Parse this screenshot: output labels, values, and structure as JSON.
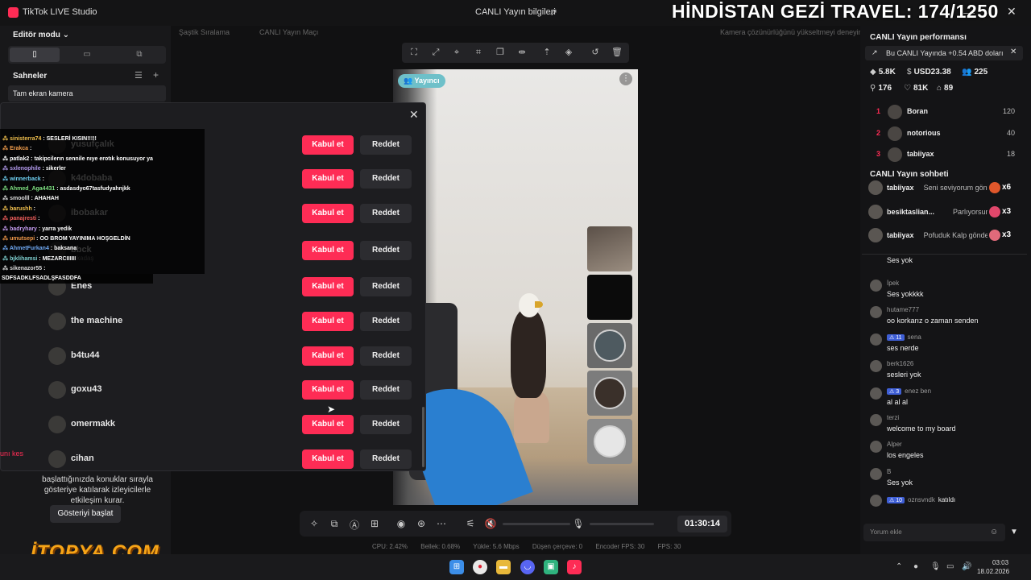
{
  "app": {
    "title": "TikTok LIVE Studio",
    "center_title": "CANLI Yayın bilgileri",
    "overlay_title": "HİNDİSTAN GEZİ TRAVEL: 174/1250"
  },
  "left": {
    "editor_mode": "Editör modu ⌄",
    "scenes_label": "Sahneler",
    "scene_item": "Tam ekran kamera",
    "show_description": "başlattığınızda konuklar sırayla gösteriye katılarak izleyicilerle etkileşim kurar.",
    "start_show": "Gösteriyi başlat",
    "cut_text": "unı kes"
  },
  "hints": {
    "h1": "Şaştik Sıralama",
    "h2": "CANLI Yayın Maçı",
    "h3": "Kamera çözünürlüğünü yükseltmeyi deneyin"
  },
  "video": {
    "badge": "👥 Yayıncı"
  },
  "modal": {
    "requests": [
      {
        "name": "yusufçalık",
        "accept": "Kabul et",
        "reject": "Reddet"
      },
      {
        "name": "k4dobaba",
        "accept": "Kabul et",
        "reject": "Reddet"
      },
      {
        "name": "ibobakar",
        "accept": "Kabul et",
        "reject": "Reddet"
      },
      {
        "name": "bbck",
        "sub": "arkadaş",
        "accept": "Kabul et",
        "reject": "Reddet"
      },
      {
        "name": "Enes",
        "accept": "Kabul et",
        "reject": "Reddet"
      },
      {
        "name": "the machine",
        "accept": "Kabul et",
        "reject": "Reddet"
      },
      {
        "name": "b4tu44",
        "accept": "Kabul et",
        "reject": "Reddet"
      },
      {
        "name": "goxu43",
        "accept": "Kabul et",
        "reject": "Reddet"
      },
      {
        "name": "omermakk",
        "accept": "Kabul et",
        "reject": "Reddet"
      },
      {
        "name": "cihan",
        "accept": "Kabul et",
        "reject": "Reddet"
      }
    ]
  },
  "overlay_chat": [
    {
      "user": "sinisterra74",
      "text": "SESLERİ KISIN!!!!!",
      "color": "#f2c14e"
    },
    {
      "user": "Erakca",
      "text": "",
      "color": "#f29e4c"
    },
    {
      "user": "patlak2",
      "text": "takipcilerın sennile nıye erotık konusuyor ya",
      "color": "#ffffff"
    },
    {
      "user": "sxlenophile",
      "text": "sikerler",
      "color": "#b59cf0"
    },
    {
      "user": "winnerback",
      "text": "",
      "color": "#6fd0f2"
    },
    {
      "user": "Ahmed_Aga4431",
      "text": "asdasdyo67tasfudyahnjkk",
      "color": "#7ee081"
    },
    {
      "user": "smoolll",
      "text": "AHAHAH",
      "color": "#dddddd"
    },
    {
      "user": "barushh",
      "text": "",
      "color": "#f2c14e"
    },
    {
      "user": "panajresti",
      "text": "",
      "color": "#f25f5c"
    },
    {
      "user": "badryhary",
      "text": "yarra yedik",
      "color": "#c49cf0"
    },
    {
      "user": "umutsepi",
      "text": "OO BROM YAYINIMA HOŞGELDİN",
      "color": "#f2994a"
    },
    {
      "user": "AhmetFurkan4",
      "text": "baksana",
      "color": "#6fa8f2"
    },
    {
      "user": "bjklihamsi",
      "text": "MEZARCIIIIII",
      "color": "#7fd1d1"
    },
    {
      "user": "sikenazor55",
      "text": "",
      "color": "#dddddd"
    }
  ],
  "overlay_bottom": "SDFSADKLFSADLŞFASDDFA",
  "controls": {
    "timer": "01:30:14"
  },
  "stats": {
    "cpu": "CPU: 2.42%",
    "memory": "Bellek: 0.68%",
    "upload": "Yükle: 5.6 Mbps",
    "dropped": "Düşen çerçeve: 0",
    "encoder_fps": "Encoder FPS: 30",
    "fps": "FPS: 30"
  },
  "right": {
    "perf_title": "CANLI Yayın performansı",
    "perf_banner": "Bu CANLI Yayında +0.54 ABD doları",
    "metrics": {
      "diamonds": "5.8K",
      "usd": "USD23.38",
      "viewers": "225",
      "followers": "176",
      "likes": "81K",
      "gifts": "89"
    },
    "ranking": [
      {
        "rank": "1",
        "name": "Boran",
        "score": "120"
      },
      {
        "rank": "2",
        "name": "notorious",
        "score": "40"
      },
      {
        "rank": "3",
        "name": "tabiiyax",
        "score": "18"
      }
    ],
    "chat_title": "CANLI Yayın sohbeti",
    "gifts": [
      {
        "user": "tabiiyax",
        "text": "Seni seviyorum gönd",
        "count": "x6",
        "color": "#e0572b"
      },
      {
        "user": "besiktaslian...",
        "text": "Parlıyorsun! gö",
        "count": "x3",
        "color": "#e0476b"
      },
      {
        "user": "tabiiyax",
        "text": "Pofuduk Kalp gönder",
        "count": "x3",
        "color": "#e06a7a"
      }
    ],
    "messages": [
      {
        "user": "İpek",
        "badge": "",
        "text": "Ses yokkkk"
      },
      {
        "user": "hutame777",
        "badge": "",
        "text": "oo korkarız o zaman senden"
      },
      {
        "user": "sena",
        "badge": "11",
        "text": "ses nerde"
      },
      {
        "user": "berk1626",
        "badge": "",
        "text": "sesleri yok"
      },
      {
        "user": "enez ben",
        "badge": "3",
        "text": "al al al"
      },
      {
        "user": "terzi",
        "badge": "",
        "text": "welcome to my board"
      },
      {
        "user": "Alper",
        "badge": "",
        "text": "los engeles"
      },
      {
        "user": "B",
        "badge": "",
        "text": "Ses yok"
      },
      {
        "user": "oznsvndk",
        "badge": "10",
        "text": "katıldı"
      }
    ],
    "chat_top_partial": "Ses yok",
    "chat_input_placeholder": "Yorum ekle"
  },
  "taskbar": {
    "time": "03:03",
    "date": "18.02.2026"
  }
}
